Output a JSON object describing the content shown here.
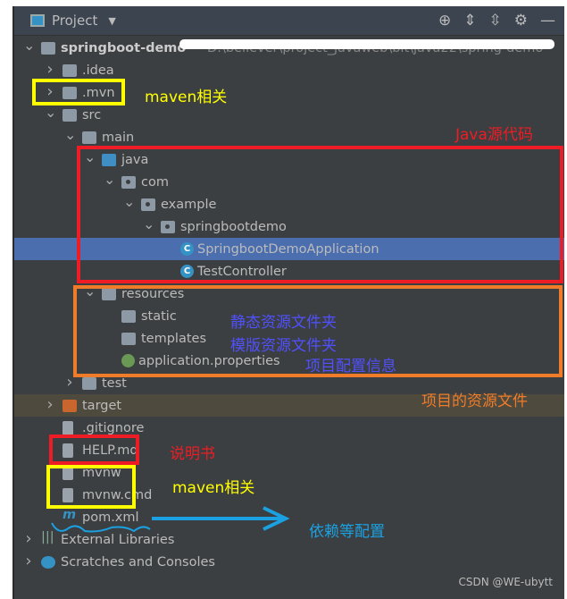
{
  "header": {
    "title": "Project",
    "icons": [
      "locate-icon",
      "expand-all-icon",
      "collapse-all-icon",
      "gear-icon",
      "minimize-icon"
    ]
  },
  "tree": [
    {
      "label": "springboot-demo",
      "path": "D:\\believer\\project_javaweb\\bit\\java22\\spring-demo",
      "level": 0,
      "chev": "v",
      "icon": "module"
    },
    {
      "label": ".idea",
      "level": 1,
      "chev": ">",
      "icon": "folder"
    },
    {
      "label": ".mvn",
      "level": 1,
      "chev": ">",
      "icon": "folder"
    },
    {
      "label": "src",
      "level": 1,
      "chev": "v",
      "icon": "folder"
    },
    {
      "label": "main",
      "level": 2,
      "chev": "v",
      "icon": "folder"
    },
    {
      "label": "java",
      "level": 3,
      "chev": "v",
      "icon": "folder-blue"
    },
    {
      "label": "com",
      "level": 4,
      "chev": "v",
      "icon": "package"
    },
    {
      "label": "example",
      "level": 5,
      "chev": "v",
      "icon": "package"
    },
    {
      "label": "springbootdemo",
      "level": 6,
      "chev": "v",
      "icon": "package"
    },
    {
      "label": "SpringbootDemoApplication",
      "level": 7,
      "icon": "class",
      "selected": true
    },
    {
      "label": "TestController",
      "level": 7,
      "icon": "class"
    },
    {
      "label": "resources",
      "level": 3,
      "chev": "v",
      "icon": "folder-resources"
    },
    {
      "label": "static",
      "level": 4,
      "icon": "folder"
    },
    {
      "label": "templates",
      "level": 4,
      "icon": "folder"
    },
    {
      "label": "application.properties",
      "level": 4,
      "icon": "spring-properties"
    },
    {
      "label": "test",
      "level": 2,
      "chev": ">",
      "icon": "folder"
    },
    {
      "label": "target",
      "level": 1,
      "chev": ">",
      "icon": "folder-orange",
      "excluded": true
    },
    {
      "label": ".gitignore",
      "level": 1,
      "icon": "file"
    },
    {
      "label": "HELP.md",
      "level": 1,
      "icon": "markdown"
    },
    {
      "label": "mvnw",
      "level": 1,
      "icon": "shell"
    },
    {
      "label": "mvnw.cmd",
      "level": 1,
      "icon": "file"
    },
    {
      "label": "pom.xml",
      "level": 1,
      "icon": "maven"
    },
    {
      "label": "External Libraries",
      "level": 0,
      "chev": ">",
      "icon": "libraries"
    },
    {
      "label": "Scratches and Consoles",
      "level": 0,
      "chev": ">",
      "icon": "scratches"
    }
  ],
  "annotations": {
    "maven1": "maven相关",
    "java": "Java源代码",
    "static": "静态资源文件夹",
    "templates": "模版资源文件夹",
    "props": "项目配置信息",
    "resources": "项目的资源文件",
    "help": "说明书",
    "maven2": "maven相关",
    "pom": "依赖等配置"
  },
  "watermark": "CSDN @WE-ubytt",
  "colors": {
    "selected": "#4b6eaf",
    "yellow": "#ffff00",
    "red": "#ee1c24",
    "orange": "#f07c2a",
    "blue": "#1ba1e2",
    "purple": "#5050ff"
  }
}
